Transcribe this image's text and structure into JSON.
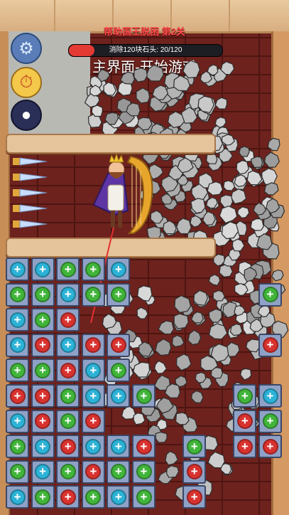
{
  "header": {
    "level_title": "帮助国王脱困 第2关",
    "progress_label": "消除120块石头: 20/120",
    "progress_fraction": 0.1667,
    "main_menu_label": "主界面-开始游戏"
  },
  "tools": {
    "settings_icon": "gear-icon",
    "timer_icon": "stopwatch-icon",
    "bomb_icon": "bomb-icon"
  },
  "colors": {
    "green": "#41b43a",
    "cyan": "#2cb2d6",
    "red": "#d8322f",
    "tile": "#8fa1c6",
    "rock": "#9c9c9c",
    "spike": "#c8ddff"
  },
  "board": {
    "rows": [
      [
        "cyan",
        "cyan",
        "green",
        "green",
        "cyan",
        null,
        null,
        null,
        null,
        null,
        null
      ],
      [
        "green",
        "green",
        "cyan",
        "green",
        "green",
        null,
        null,
        null,
        null,
        null,
        "green"
      ],
      [
        "cyan",
        "green",
        "red",
        null,
        null,
        null,
        null,
        null,
        null,
        null,
        null
      ],
      [
        "cyan",
        "red",
        "cyan",
        "red",
        "red",
        null,
        null,
        null,
        null,
        null,
        "red"
      ],
      [
        "green",
        "green",
        "red",
        "cyan",
        "green",
        null,
        null,
        null,
        null,
        null,
        null
      ],
      [
        "red",
        "red",
        "green",
        "cyan",
        "cyan",
        "green",
        null,
        null,
        null,
        "green",
        "cyan"
      ],
      [
        "cyan",
        "red",
        "green",
        "red",
        null,
        null,
        null,
        null,
        null,
        "red",
        "green"
      ],
      [
        "green",
        "cyan",
        "red",
        "cyan",
        "cyan",
        "red",
        null,
        "green",
        null,
        "red",
        "red"
      ],
      [
        "green",
        "cyan",
        "green",
        "red",
        "green",
        "green",
        null,
        "red",
        null,
        null,
        null
      ],
      [
        "cyan",
        "green",
        "red",
        "green",
        "cyan",
        "green",
        null,
        "red",
        null,
        null,
        null
      ]
    ]
  }
}
